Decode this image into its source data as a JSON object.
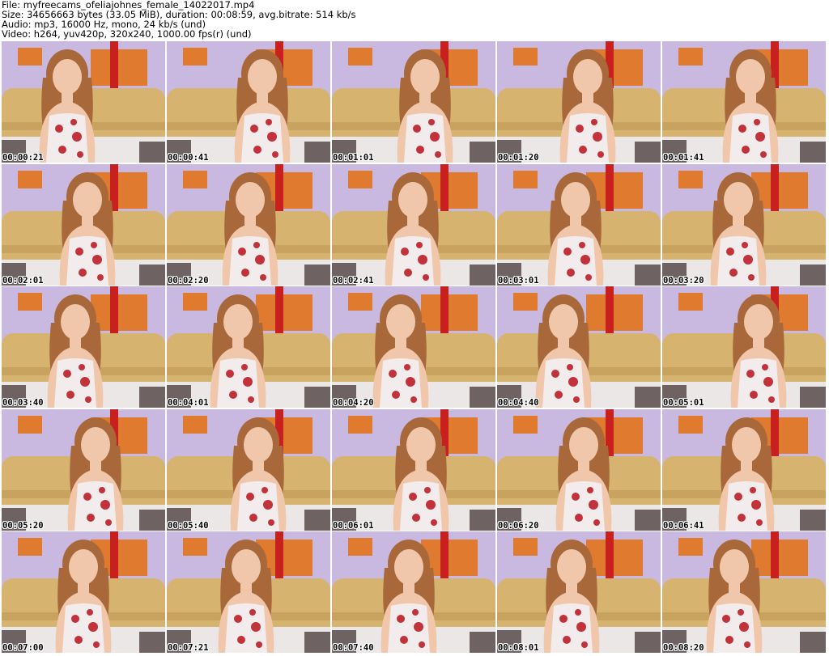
{
  "header": {
    "file_line": "File: myfreecams_ofeliajohnes_female_14022017.mp4",
    "size_line": "Size: 34656663 bytes (33.05 MiB), duration: 00:08:59, avg.bitrate: 514 kb/s",
    "audio_line": "Audio: mp3, 16000 Hz, mono, 24 kb/s (und)",
    "video_line": "Video: h264, yuv420p, 320x240, 1000.00 fps(r) (und)"
  },
  "thumbnails": [
    {
      "timestamp": "00:00:21"
    },
    {
      "timestamp": "00:00:41"
    },
    {
      "timestamp": "00:01:01"
    },
    {
      "timestamp": "00:01:20"
    },
    {
      "timestamp": "00:01:41"
    },
    {
      "timestamp": "00:02:01"
    },
    {
      "timestamp": "00:02:20"
    },
    {
      "timestamp": "00:02:41"
    },
    {
      "timestamp": "00:03:01"
    },
    {
      "timestamp": "00:03:20"
    },
    {
      "timestamp": "00:03:40"
    },
    {
      "timestamp": "00:04:01"
    },
    {
      "timestamp": "00:04:20"
    },
    {
      "timestamp": "00:04:40"
    },
    {
      "timestamp": "00:05:01"
    },
    {
      "timestamp": "00:05:20"
    },
    {
      "timestamp": "00:05:40"
    },
    {
      "timestamp": "00:06:01"
    },
    {
      "timestamp": "00:06:20"
    },
    {
      "timestamp": "00:06:41"
    },
    {
      "timestamp": "00:07:00"
    },
    {
      "timestamp": "00:07:21"
    },
    {
      "timestamp": "00:07:40"
    },
    {
      "timestamp": "00:08:01"
    },
    {
      "timestamp": "00:08:20"
    }
  ],
  "colors": {
    "wall": "#c9b8e0",
    "sofa": "#d6b470",
    "sofa_shadow": "#b8924e",
    "frame": "#e07a2e",
    "red_accent": "#c8201e",
    "skin": "#f1c7ab",
    "hair": "#a8683a",
    "dress": "#f2ecec",
    "flower": "#c2323a"
  }
}
